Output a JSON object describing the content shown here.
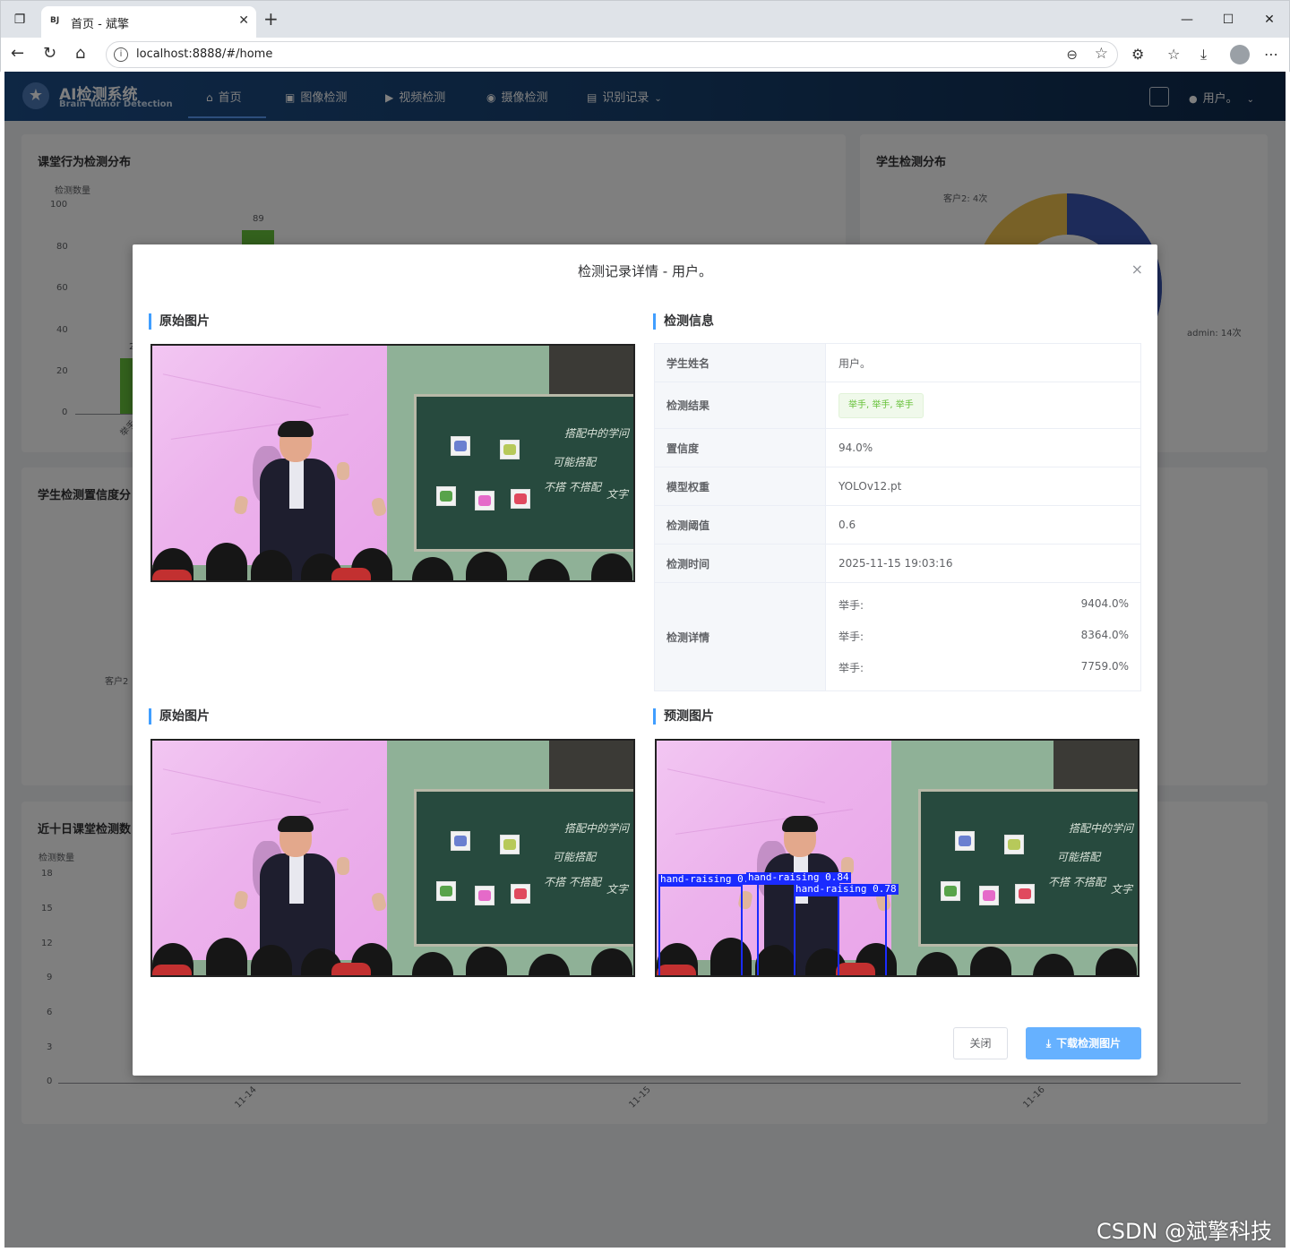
{
  "browser": {
    "tab_favicon": "BJ",
    "tab_title": "首页 - 斌擎",
    "tab_close": "✕",
    "new_tab": "+",
    "url": "localhost:8888/#/home",
    "min": "—",
    "max": "☐",
    "close": "✕"
  },
  "header": {
    "title": "AI检测系统",
    "subtitle": "Brain Tumor Detection",
    "nav": [
      {
        "label": "首页",
        "icon": "home-icon"
      },
      {
        "label": "图像检测",
        "icon": "image-icon"
      },
      {
        "label": "视频检测",
        "icon": "play-icon"
      },
      {
        "label": "摄像检测",
        "icon": "camera-icon"
      },
      {
        "label": "识别记录",
        "icon": "document-icon"
      }
    ],
    "user": "用户。"
  },
  "background": {
    "card1": {
      "title": "课堂行为检测分布",
      "ylabel": "检测数量",
      "yticks": [
        "100",
        "80",
        "60",
        "40",
        "20",
        "0"
      ],
      "bar_value": "89",
      "bar_value2": "2",
      "xlabel": "举手"
    },
    "card2": {
      "title": "学生检测分布",
      "label_a": "客户2: 4次",
      "label_b": "admin: 14次"
    },
    "card3": {
      "title": "学生检测置信度分",
      "label": "客户2"
    },
    "card4": {
      "title": "近十日课堂检测数",
      "ylabel": "检测数量",
      "yticks": [
        "18",
        "15",
        "12",
        "9",
        "6",
        "3",
        "0"
      ],
      "xticks": [
        "11-14",
        "11-15",
        "11-16"
      ]
    }
  },
  "dialog": {
    "title": "检测记录详情 - 用户。",
    "close_icon": "×",
    "section_original": "原始图片",
    "section_info": "检测信息",
    "section_original2": "原始图片",
    "section_predict": "预测图片",
    "info": {
      "name_key": "学生姓名",
      "name_val": "用户。",
      "result_key": "检测结果",
      "result_val": "举手, 举手, 举手",
      "conf_key": "置信度",
      "conf_val": "94.0%",
      "model_key": "模型权重",
      "model_val": "YOLOv12.pt",
      "thresh_key": "检测阈值",
      "thresh_val": "0.6",
      "time_key": "检测时间",
      "time_val": "2025-11-15 19:03:16",
      "detail_key": "检测详情",
      "details": [
        {
          "label": "举手:",
          "value": "9404.0%"
        },
        {
          "label": "举手:",
          "value": "8364.0%"
        },
        {
          "label": "举手:",
          "value": "7759.0%"
        }
      ]
    },
    "boxes": [
      "hand-raising 0.94",
      "hand-raising 0.84",
      "hand-raising 0.78"
    ],
    "board_text": [
      "搭配中的学问",
      "可能搭配",
      "不搭 不搭配",
      "文字"
    ],
    "btn_close": "关闭",
    "btn_download": "下载检测图片"
  },
  "watermark": "CSDN @斌擎科技"
}
